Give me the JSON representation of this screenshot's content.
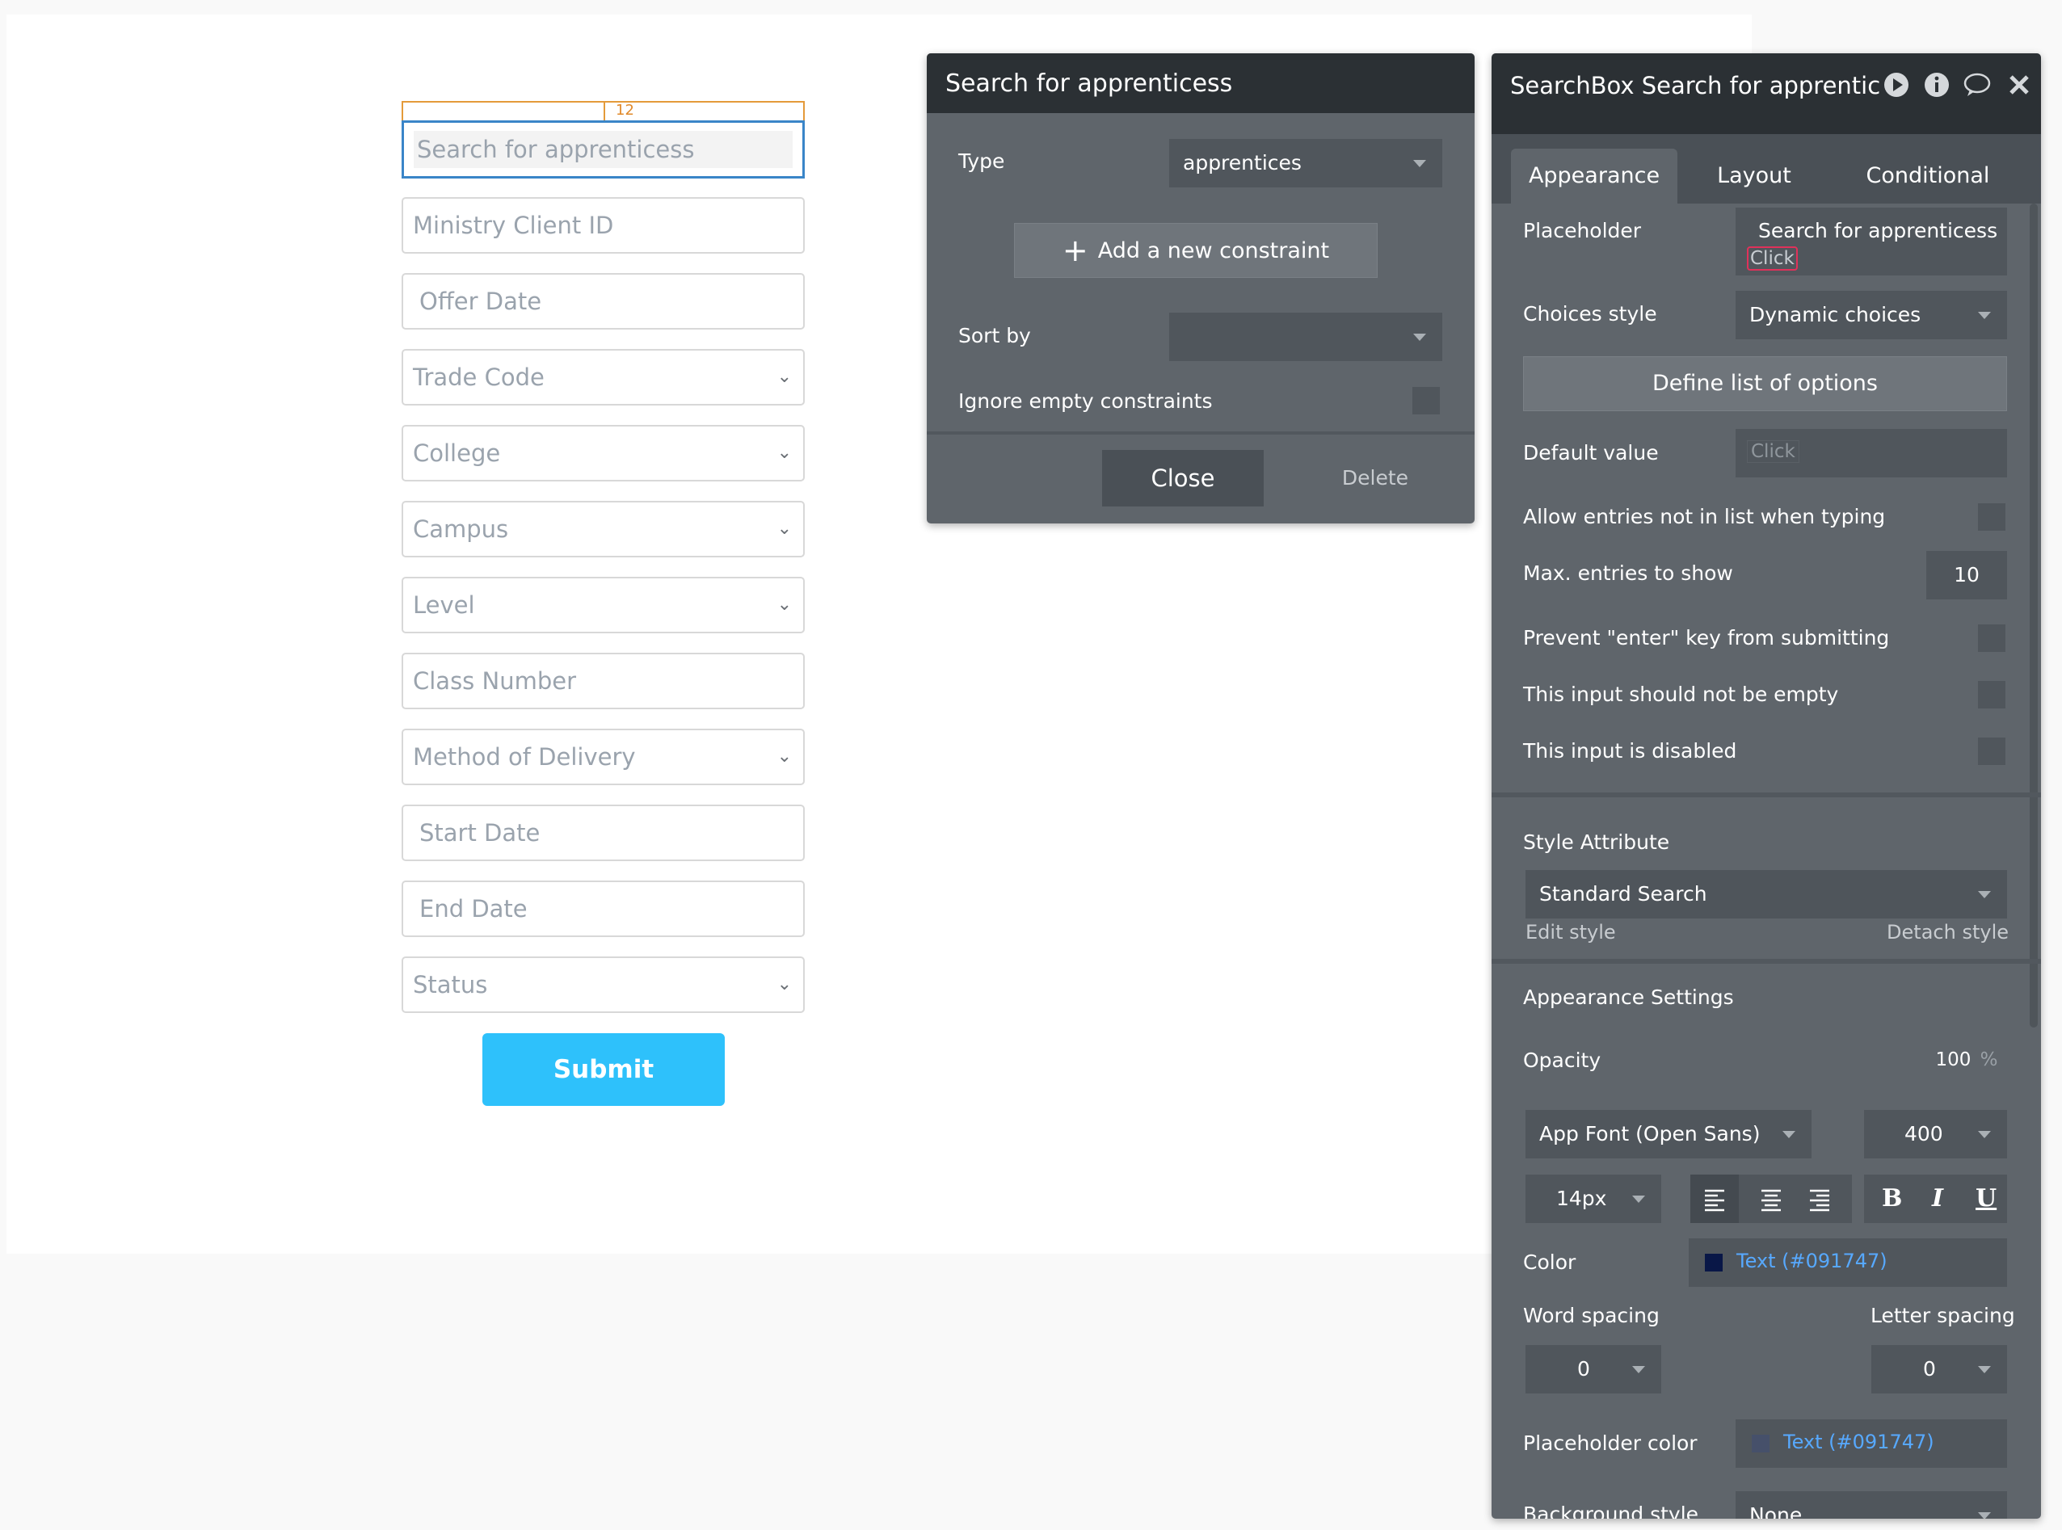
{
  "form": {
    "indicator": "12",
    "search_placeholder": "Search for apprenticess",
    "fields": [
      {
        "label": "Ministry Client ID",
        "kind": "input"
      },
      {
        "label": "Offer Date",
        "kind": "input"
      },
      {
        "label": "Trade Code",
        "kind": "dropdown"
      },
      {
        "label": "College",
        "kind": "dropdown"
      },
      {
        "label": "Campus",
        "kind": "dropdown"
      },
      {
        "label": "Level",
        "kind": "dropdown"
      },
      {
        "label": "Class Number",
        "kind": "input"
      },
      {
        "label": "Method of Delivery",
        "kind": "dropdown"
      },
      {
        "label": "Start Date",
        "kind": "input"
      },
      {
        "label": "End Date",
        "kind": "input"
      },
      {
        "label": "Status",
        "kind": "dropdown"
      }
    ],
    "submit_label": "Submit"
  },
  "search_popup": {
    "title": "Search for apprenticess",
    "type_label": "Type",
    "type_value": "apprentices",
    "add_constraint_label": "Add a new constraint",
    "sort_by_label": "Sort by",
    "sort_by_value": "",
    "ignore_empty_label": "Ignore empty constraints",
    "close_label": "Close",
    "delete_label": "Delete"
  },
  "inspector": {
    "title": "SearchBox Search for apprentic",
    "tabs": [
      "Appearance",
      "Layout",
      "Conditional"
    ],
    "placeholder_label": "Placeholder",
    "placeholder_value": "Search for apprenticess",
    "placeholder_click": "Click",
    "choices_style_label": "Choices style",
    "choices_style_value": "Dynamic choices",
    "define_list_label": "Define list of options",
    "default_value_label": "Default value",
    "default_value_click": "Click",
    "allow_entries_label": "Allow entries not in list when typing",
    "max_entries_label": "Max. entries to show",
    "max_entries_value": "10",
    "prevent_enter_label": "Prevent \"enter\" key from submitting",
    "not_empty_label": "This input should not be empty",
    "disabled_label": "This input is disabled",
    "style_attribute_label": "Style Attribute",
    "style_value": "Standard Search",
    "edit_style_label": "Edit style",
    "detach_style_label": "Detach style",
    "appearance_settings_label": "Appearance Settings",
    "opacity_label": "Opacity",
    "opacity_value": "100",
    "opacity_unit": "%",
    "font_value": "App Font (Open Sans)",
    "weight_value": "400",
    "size_value": "14px",
    "bold_glyph": "B",
    "italic_glyph": "I",
    "underline_glyph": "U",
    "color_label": "Color",
    "color_value": "Text (#091747)",
    "word_spacing_label": "Word spacing",
    "letter_spacing_label": "Letter spacing",
    "word_spacing_value": "0",
    "letter_spacing_value": "0",
    "placeholder_color_label": "Placeholder color",
    "placeholder_color_value": "Text (#091747)",
    "background_style_label": "Background style",
    "background_style_value": "None"
  },
  "colors": {
    "accent_blue": "#2ec1fb",
    "text_swatch": "#091747",
    "link_blue": "#57a9ff",
    "selection_orange": "#e49a3a"
  }
}
